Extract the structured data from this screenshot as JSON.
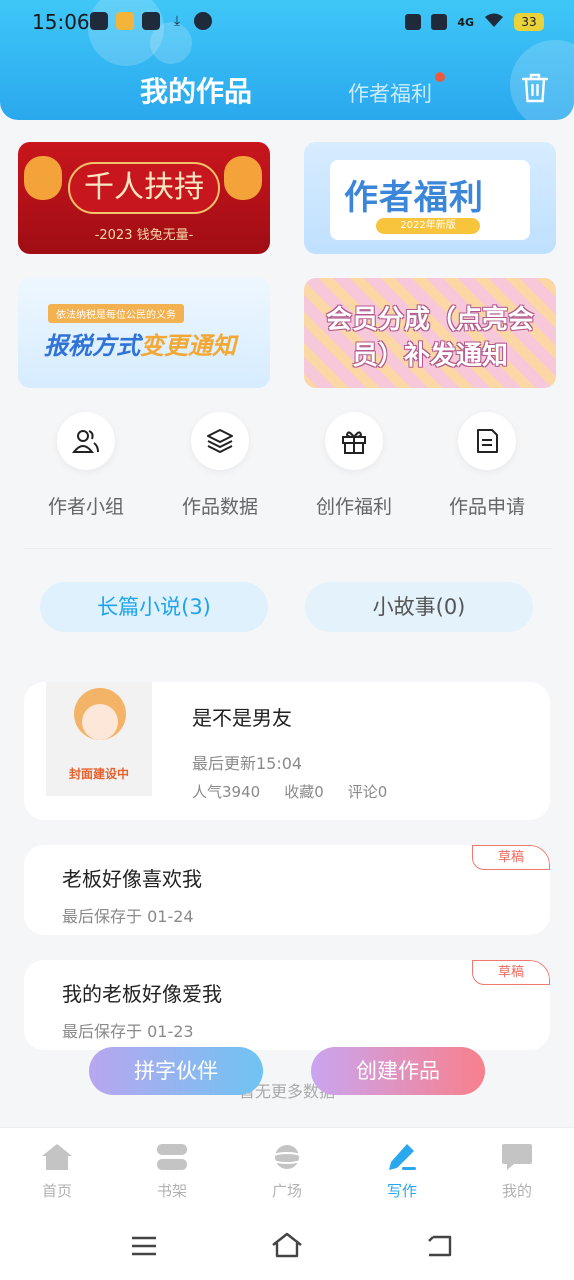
{
  "statusbar": {
    "time": "15:06",
    "battery": "33",
    "network": "4G"
  },
  "header": {
    "title": "我的作品",
    "tab_welfare": "作者福利"
  },
  "banners": {
    "b1": {
      "title": "千人扶持",
      "subtitle": "-2023 钱兔无量-"
    },
    "b2": {
      "title": "作者福利",
      "pill": "2022年新版"
    },
    "b3": {
      "tag": "依法纳税是每位公民的义务",
      "title_a": "报税方式",
      "title_b": "变更通知"
    },
    "b4": {
      "line1": "会员分成（点亮会",
      "line2": "员）补发通知"
    }
  },
  "quick": [
    {
      "label": "作者小组",
      "icon": "users-icon"
    },
    {
      "label": "作品数据",
      "icon": "layers-icon"
    },
    {
      "label": "创作福利",
      "icon": "gift-icon"
    },
    {
      "label": "作品申请",
      "icon": "document-icon"
    }
  ],
  "segments": {
    "long": "长篇小说(3)",
    "short": "小故事(0)"
  },
  "works": {
    "published": {
      "title": "是不是男友",
      "cover_label": "封面建设中",
      "updated": "最后更新15:04",
      "popularity": "人气3940",
      "favorites": "收藏0",
      "comments": "评论0"
    },
    "drafts": [
      {
        "title": "老板好像喜欢我",
        "saved": "最后保存于  01-24",
        "badge": "草稿"
      },
      {
        "title": "我的老板好像爱我",
        "saved": "最后保存于  01-23",
        "badge": "草稿"
      }
    ]
  },
  "no_more": "暂无更多数据",
  "fab": {
    "partner": "拼字伙伴",
    "create": "创建作品"
  },
  "nav": [
    {
      "label": "首页",
      "icon": "home-icon"
    },
    {
      "label": "书架",
      "icon": "bookshelf-icon"
    },
    {
      "label": "广场",
      "icon": "planet-icon"
    },
    {
      "label": "写作",
      "icon": "pen-icon"
    },
    {
      "label": "我的",
      "icon": "chat-icon"
    }
  ],
  "colors": {
    "accent": "#2aa8ee",
    "draft": "#ef6a5e"
  }
}
